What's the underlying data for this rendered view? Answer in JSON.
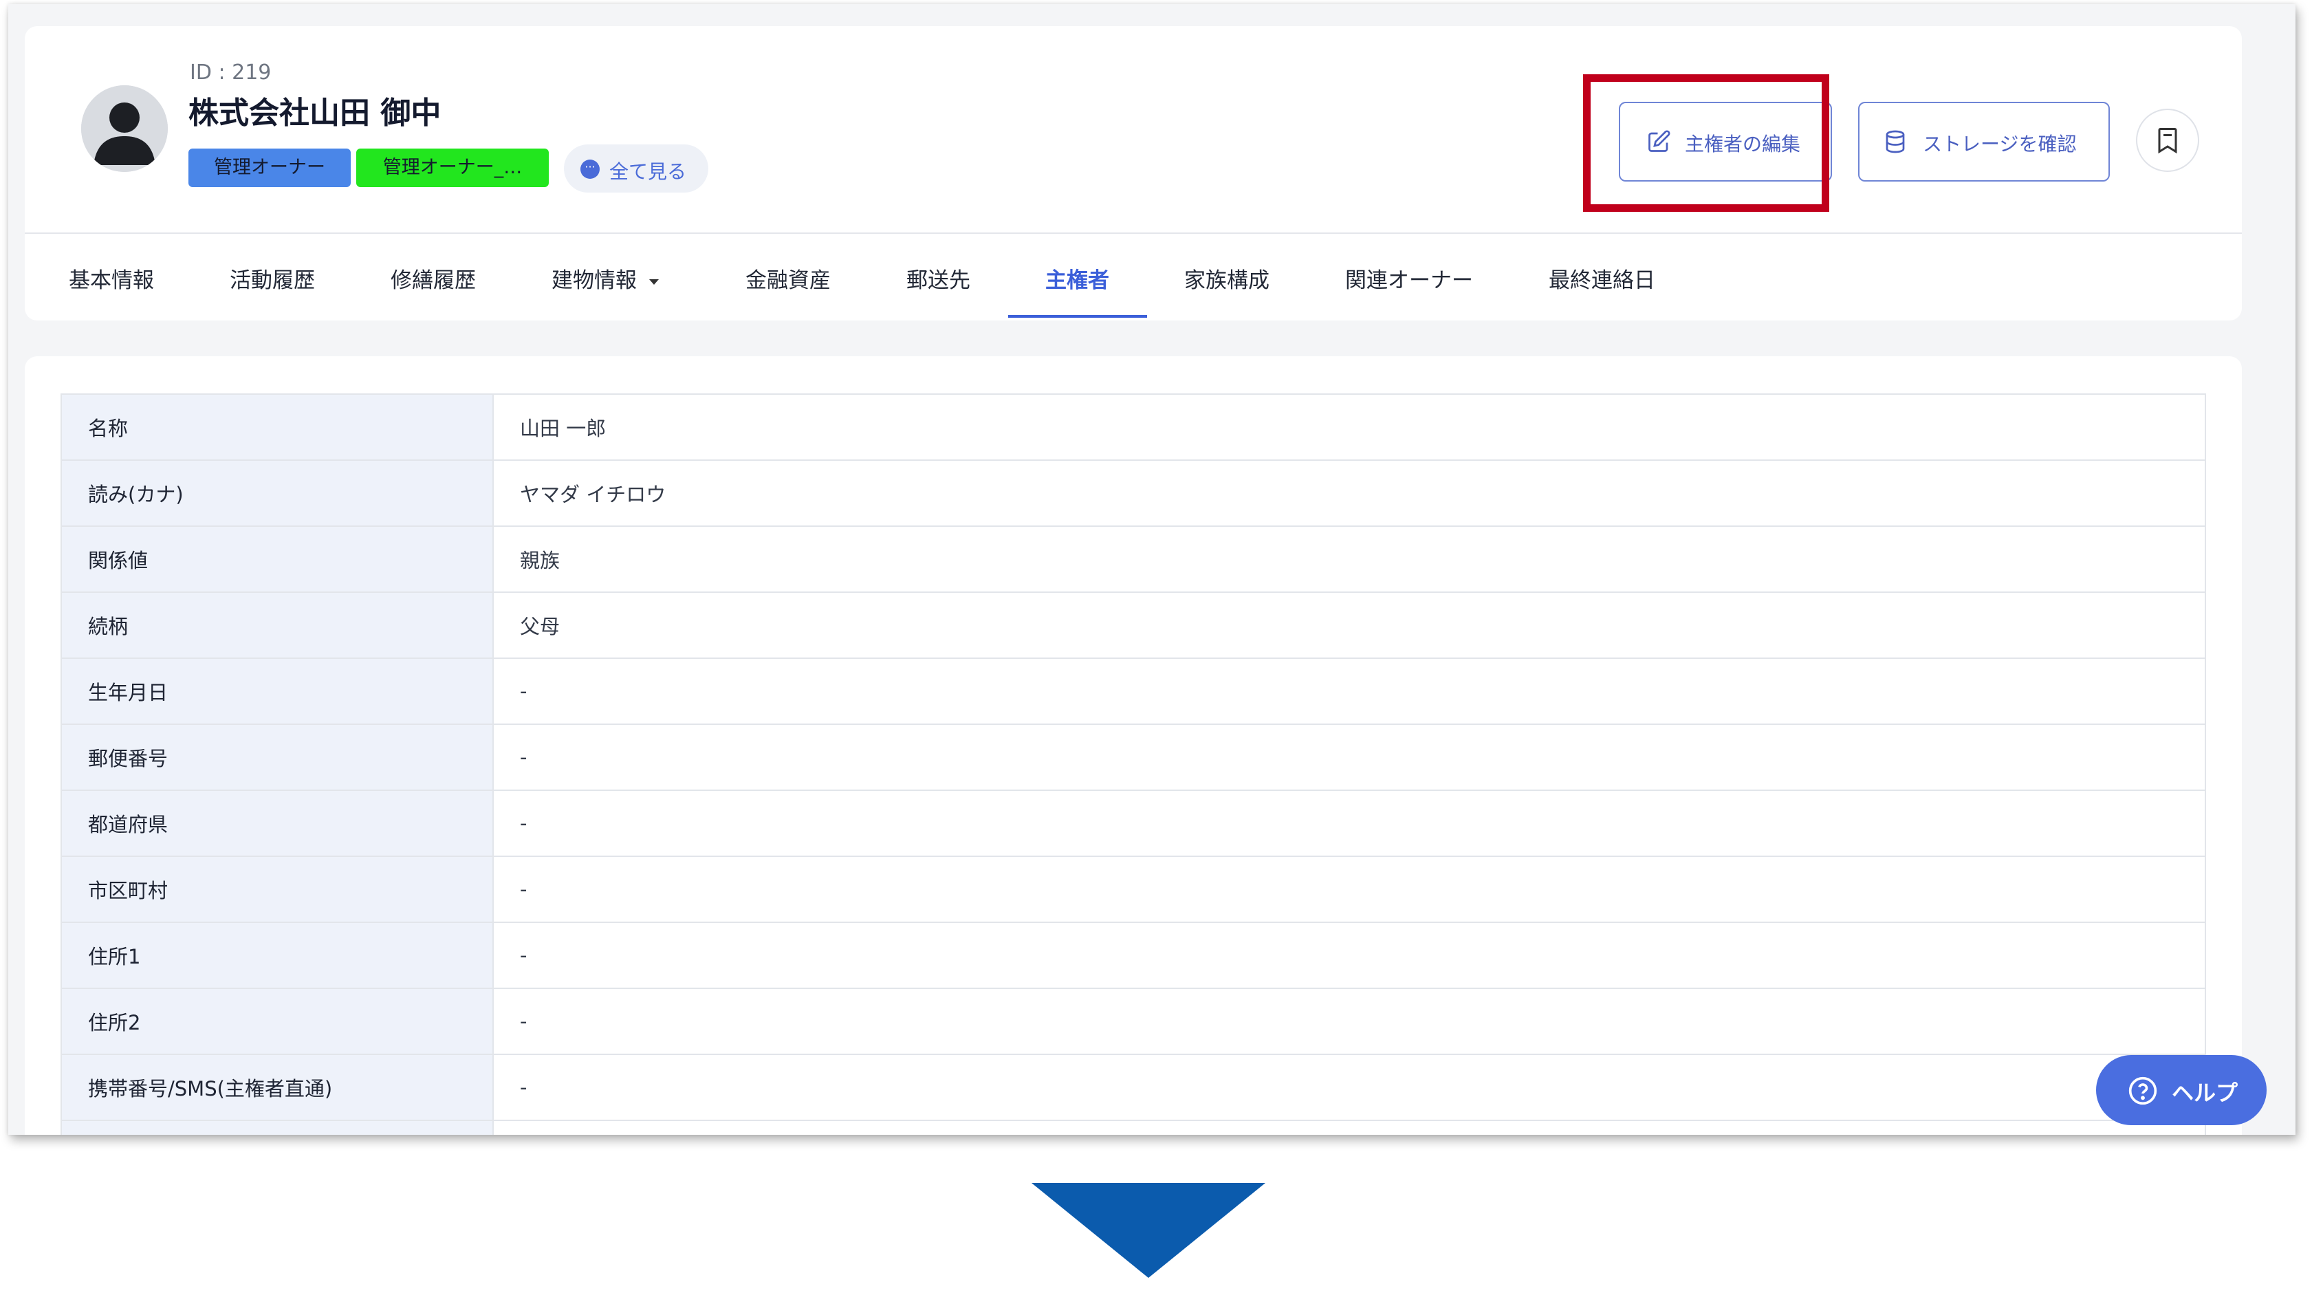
{
  "header": {
    "id_label": "ID : 219",
    "company_name": "株式会社山田 御中",
    "tags": [
      "管理オーナー",
      "管理オーナー_…"
    ],
    "view_all_label": "全て見る"
  },
  "actions": {
    "edit_label": "主権者の編集",
    "storage_label": "ストレージを確認"
  },
  "tabs": [
    {
      "label": "基本情報"
    },
    {
      "label": "活動履歴"
    },
    {
      "label": "修繕履歴"
    },
    {
      "label": "建物情報"
    },
    {
      "label": "金融資産"
    },
    {
      "label": "郵送先"
    },
    {
      "label": "主権者",
      "active": true
    },
    {
      "label": "家族構成"
    },
    {
      "label": "関連オーナー"
    },
    {
      "label": "最終連絡日"
    }
  ],
  "details": [
    {
      "key": "名称",
      "value": "山田 一郎"
    },
    {
      "key": "読み(カナ)",
      "value": "ヤマダ イチロウ"
    },
    {
      "key": "関係値",
      "value": "親族"
    },
    {
      "key": "続柄",
      "value": "父母"
    },
    {
      "key": "生年月日",
      "value": "-"
    },
    {
      "key": "郵便番号",
      "value": "-"
    },
    {
      "key": "都道府県",
      "value": "-"
    },
    {
      "key": "市区町村",
      "value": "-"
    },
    {
      "key": "住所1",
      "value": "-"
    },
    {
      "key": "住所2",
      "value": "-"
    },
    {
      "key": "携帯番号/SMS(主権者直通)",
      "value": "-"
    }
  ],
  "help": {
    "label": "ヘルプ"
  },
  "colors": {
    "accent": "#3b5fd9",
    "highlight": "#c0001b",
    "tag_blue": "#4a86e8",
    "tag_green": "#22e61e",
    "arrow": "#0b5bad"
  }
}
